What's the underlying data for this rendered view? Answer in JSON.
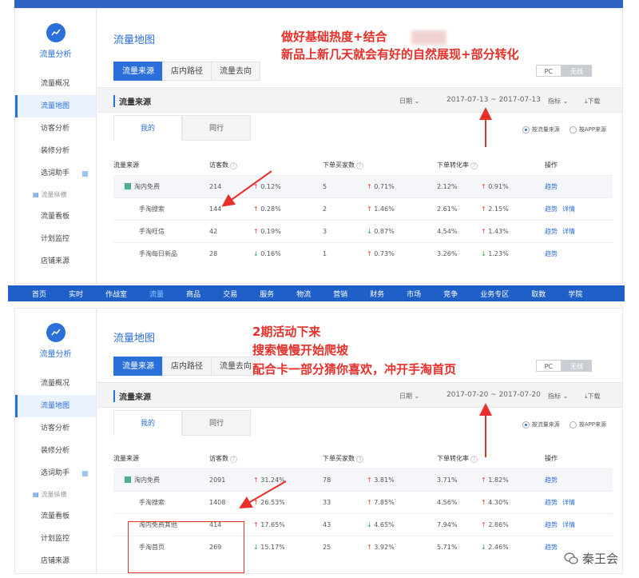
{
  "panel1": {
    "sidebar": {
      "title": "流量分析",
      "items": [
        "流量概况",
        "流量地图",
        "访客分析",
        "装修分析",
        "选词助手"
      ],
      "group": "流量纵横",
      "items2": [
        "流量看板",
        "计划监控",
        "店铺来源"
      ]
    },
    "title": "流量地图",
    "tabs": [
      "流量来源",
      "店内路径",
      "流量去向"
    ],
    "toggle": {
      "pc": "PC",
      "wx": "无线"
    },
    "section_title": "流量来源",
    "date_label": "日期",
    "date_range": "2017-07-13 ~ 2017-07-13",
    "metric_label": "指标",
    "download": "下载",
    "subtabs": [
      "我的",
      "同行"
    ],
    "radios": [
      "按流量来源",
      "按APP来源"
    ],
    "headers": [
      "流量来源",
      "访客数",
      "下单买家数",
      "下单转化率",
      "操作"
    ],
    "rows": [
      {
        "name": "淘内免费",
        "visitors": "214",
        "visitors_change": "0.12%",
        "visitors_dir": "up",
        "buyers": "5",
        "buyers_change": "0.71%",
        "buyers_dir": "up",
        "rate": "2.12%",
        "rate_change": "0.91%",
        "rate_dir": "up",
        "ops": [
          "趋势"
        ]
      },
      {
        "name": "手淘搜索",
        "visitors": "144",
        "visitors_change": "0.28%",
        "visitors_dir": "up",
        "buyers": "2",
        "buyers_change": "1.46%",
        "buyers_dir": "up",
        "rate": "2.61%",
        "rate_change": "2.15%",
        "rate_dir": "up",
        "ops": [
          "趋势",
          "详情"
        ]
      },
      {
        "name": "手淘旺信",
        "visitors": "42",
        "visitors_change": "0.19%",
        "visitors_dir": "up",
        "buyers": "3",
        "buyers_change": "0.87%",
        "buyers_dir": "down",
        "rate": "4.54%",
        "rate_change": "1.43%",
        "rate_dir": "up",
        "ops": [
          "趋势",
          "详情"
        ]
      },
      {
        "name": "手淘每日新品",
        "visitors": "28",
        "visitors_change": "0.16%",
        "visitors_dir": "down",
        "buyers": "1",
        "buyers_change": "0.73%",
        "buyers_dir": "up",
        "rate": "3.26%",
        "rate_change": "1.23%",
        "rate_dir": "down",
        "ops": [
          "趋势"
        ]
      }
    ],
    "annotation": [
      "做好基础热度+结合",
      "新品上新几天就会有好的自然展现+部分转化"
    ]
  },
  "navbar": [
    "首页",
    "实时",
    "作战室",
    "流量",
    "商品",
    "交易",
    "服务",
    "物流",
    "营销",
    "财务",
    "市场",
    "竞争",
    "业务专区",
    "取数",
    "学院"
  ],
  "panel2": {
    "title": "流量地图",
    "tabs": [
      "流量来源",
      "店内路径",
      "流量去向"
    ],
    "toggle": {
      "pc": "PC",
      "wx": "无线"
    },
    "section_title": "流量来源",
    "date_label": "日期",
    "date_range": "2017-07-20 ~ 2017-07-20",
    "metric_label": "指标",
    "download": "下载",
    "subtabs": [
      "我的",
      "同行"
    ],
    "radios": [
      "按流量来源",
      "按APP来源"
    ],
    "headers": [
      "流量来源",
      "访客数",
      "下单买家数",
      "下单转化率",
      "操作"
    ],
    "rows": [
      {
        "name": "淘内免费",
        "visitors": "2091",
        "visitors_change": "31.24%",
        "visitors_dir": "up",
        "buyers": "78",
        "buyers_change": "3.81%",
        "buyers_dir": "up",
        "rate": "3.71%",
        "rate_change": "1.82%",
        "rate_dir": "up",
        "ops": [
          "趋势"
        ]
      },
      {
        "name": "手淘搜索",
        "visitors": "1408",
        "visitors_change": "26.53%",
        "visitors_dir": "up",
        "buyers": "33",
        "buyers_change": "7.85%",
        "buyers_dir": "up",
        "rate": "4.56%",
        "rate_change": "4.30%",
        "rate_dir": "up",
        "ops": [
          "趋势",
          "详情"
        ]
      },
      {
        "name": "淘内免费其他",
        "visitors": "414",
        "visitors_change": "17.65%",
        "visitors_dir": "up",
        "buyers": "43",
        "buyers_change": "4.65%",
        "buyers_dir": "down",
        "rate": "7.94%",
        "rate_change": "2.86%",
        "rate_dir": "up",
        "ops": [
          "趋势",
          "详情"
        ]
      },
      {
        "name": "手淘首页",
        "visitors": "269",
        "visitors_change": "15.17%",
        "visitors_dir": "down",
        "buyers": "25",
        "buyers_change": "3.92%",
        "buyers_dir": "up",
        "rate": "5.71%",
        "rate_change": "2.46%",
        "rate_dir": "down",
        "ops": [
          "趋势"
        ]
      }
    ],
    "annotation": [
      "2期活动下来",
      "搜索慢慢开始爬坡",
      "配合卡一部分猜你喜欢，冲开手淘首页"
    ]
  },
  "watermark": "秦王会",
  "colors": {
    "accent": "#2b6fd8",
    "annotation": "#e8302a",
    "up": "#e0483b",
    "down": "#2fa44f",
    "navbar": "#1f5fc8"
  }
}
